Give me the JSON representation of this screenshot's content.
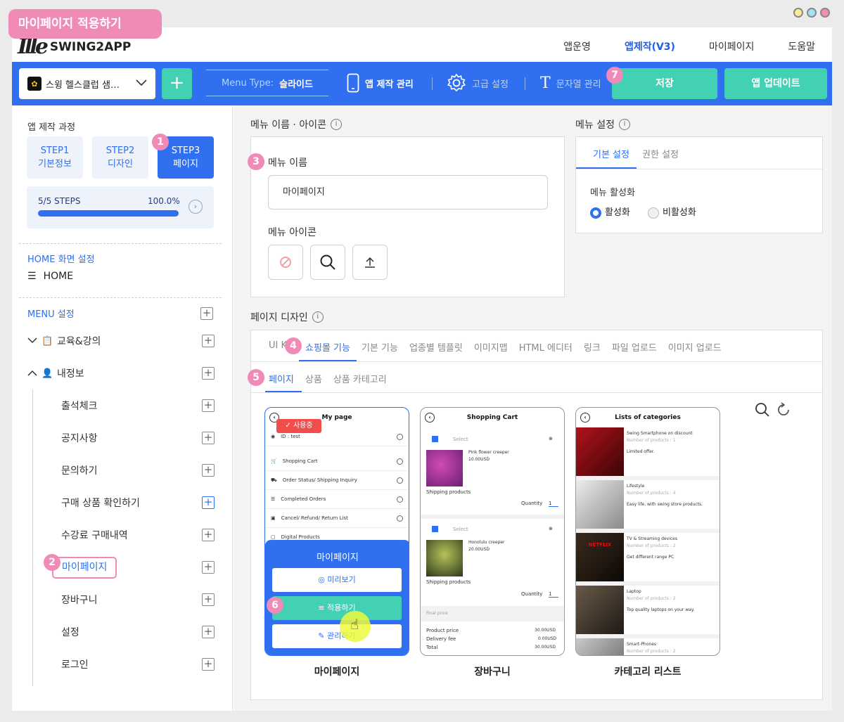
{
  "window_title": "마이페이지 적용하기",
  "brand": {
    "logo_mark": "Ille",
    "name": "SWING2APP"
  },
  "topnav": [
    "앱운영",
    "앱제작(V3)",
    "마이페이지",
    "도움말"
  ],
  "toolbar": {
    "app_name": "스윙 헬스클럽 샘…",
    "menu_type_label": "Menu Type:",
    "menu_type_value": "슬라이드",
    "app_manage": "앱 제작 관리",
    "advanced": "고급 설정",
    "strings": "문자열 관리",
    "save": "저장",
    "update": "앱 업데이트"
  },
  "sidebar": {
    "title": "앱 제작 과정",
    "steps": [
      {
        "line1": "STEP1",
        "line2": "기본정보"
      },
      {
        "line1": "STEP2",
        "line2": "디자인"
      },
      {
        "line1": "STEP3",
        "line2": "페이지"
      }
    ],
    "progress_label": "5/5 STEPS",
    "progress_pct": "100.0%",
    "progress_value": 1.0,
    "home_section": "HOME 화면 설정",
    "home_item": "HOME",
    "menu_section": "MENU 설정",
    "groups": [
      {
        "label": "교육&강의",
        "expanded": false
      },
      {
        "label": "내정보",
        "expanded": true
      }
    ],
    "subitems": [
      "출석체크",
      "공지사항",
      "문의하기",
      "구매 상품 확인하기",
      "수강료 구매내역",
      "마이페이지",
      "장바구니",
      "설정",
      "로그인"
    ]
  },
  "menu_name_section": {
    "title": "메뉴 이름 · 아이콘",
    "name_label": "메뉴 이름",
    "name_value": "마이페이지",
    "icon_label": "메뉴 아이콘"
  },
  "menu_settings": {
    "title": "메뉴 설정",
    "tabs": [
      "기본 설정",
      "권한 설정"
    ],
    "activation_label": "메뉴 활성화",
    "options": [
      "활성화",
      "비활성화"
    ],
    "selected": "활성화"
  },
  "page_design": {
    "title": "페이지 디자인",
    "tabs": [
      "UI K",
      "쇼핑몰 기능",
      "기본 기능",
      "업종별 템플릿",
      "이미지맵",
      "HTML 에디터",
      "링크",
      "파일 업로드",
      "이미지 업로드"
    ],
    "subtabs": [
      "페이지",
      "상품",
      "상품 카테고리"
    ]
  },
  "cards": {
    "mypage": {
      "header": "My page",
      "using_badge": "사용중",
      "rows": [
        "ID : test",
        "Shopping Cart",
        "Order Status/ Shipping Inquiry",
        "Completed Orders",
        "Cancel/ Refund/ Return List",
        "Digital Products"
      ],
      "overlay_title": "마이페이지",
      "preview": "미리보기",
      "apply": "적용하기",
      "manage": "관리하기",
      "label": "마이페이지"
    },
    "cart": {
      "header": "Shopping Cart",
      "select": "Select",
      "item1_name": "Pink flower creeper",
      "item1_price": "10.00USD",
      "item2_name": "Honolulu creeper",
      "item2_price": "20.00USD",
      "shipping": "Shipping products",
      "quantity": "Quantity",
      "qty": "1",
      "final": "Final price",
      "product_price": "Product price",
      "product_price_val": "30.00USD",
      "delivery": "Delivery fee",
      "delivery_val": "0.00USD",
      "total": "Total",
      "total_val": "30.00USD",
      "label": "장바구니"
    },
    "category": {
      "header": "Lists of categories",
      "items": [
        {
          "title": "Swing Smartphone on discount",
          "count": "Number of products : 1",
          "desc": "Limited offer."
        },
        {
          "title": "Lifestyle",
          "count": "Number of products : 4",
          "desc": "Easy life, with swing store products."
        },
        {
          "title": "TV & Streaming devices",
          "count": "Number of products : 2",
          "desc": "Get different range PC"
        },
        {
          "title": "Laptop",
          "count": "Number of products : 2",
          "desc": "Top quality laptops on your way."
        },
        {
          "title": "Smart-Phones",
          "count": "Number of products : 2",
          "desc": ""
        }
      ],
      "netflix": "NETFLIX",
      "label": "카테고리 리스트"
    }
  },
  "badges": [
    "1",
    "2",
    "3",
    "4",
    "5",
    "6",
    "7"
  ],
  "colors": {
    "primary": "#2f6ff0",
    "accent": "#43d1b4",
    "highlight": "#f08bb7",
    "danger": "#f24d4d"
  }
}
